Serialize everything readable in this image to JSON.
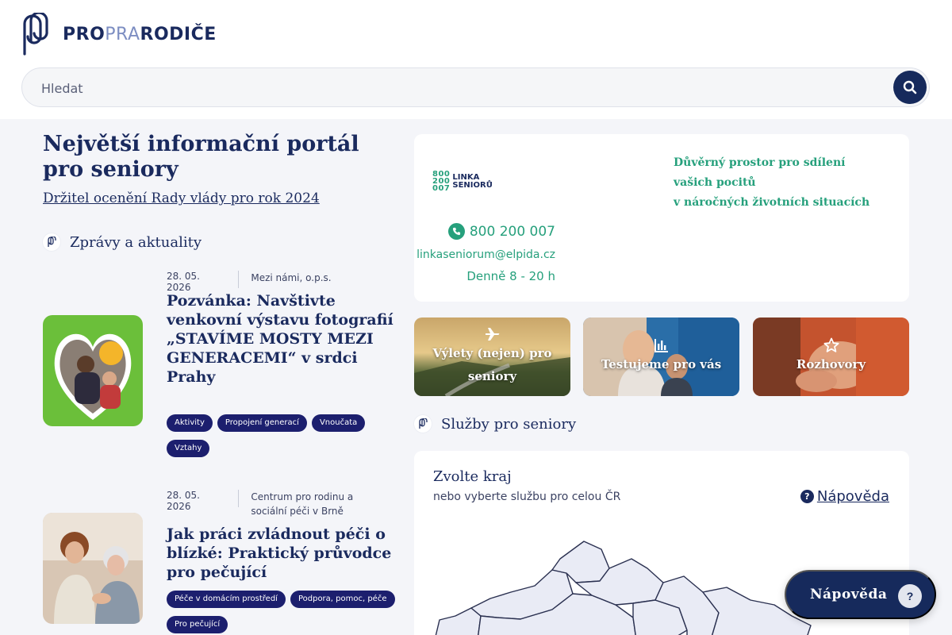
{
  "header": {
    "logo": {
      "pro1": "PRO",
      "pra": "PRA",
      "rodice": "RODIČE"
    },
    "search": {
      "placeholder": "Hledat"
    },
    "search_icon": "search-icon"
  },
  "intro": {
    "title": "Největší informační portál pro seniory",
    "award": "Držitel ocenění Rady vlády pro rok 2024"
  },
  "news": {
    "heading": "Zprávy a aktuality",
    "articles": [
      {
        "date": "28. 05. 2026",
        "org": "Mezi námi, o.p.s.",
        "title": "Pozvánka: Navštivte venkovní výstavu fotografií „STAVÍME MOSTY MEZI GENERACEMI“ v srdci Prahy",
        "tags": [
          "Aktivity",
          "Propojení generací",
          "Vnoučata",
          "Vztahy"
        ]
      },
      {
        "date": "28. 05. 2026",
        "org": "Centrum pro rodinu a sociální péči v Brně",
        "title": "Jak práci zvládnout péči o blízké: Praktický průvodce pro pečující",
        "tags": [
          "Péče v domácím prostředí",
          "Podpora, pomoc, péče",
          "Pro pečující"
        ]
      }
    ]
  },
  "linka": {
    "logo_numbers": [
      "800",
      "200",
      "007"
    ],
    "logo_word": [
      "LINKA",
      "SENIORŮ"
    ],
    "phone": "800 200 007",
    "email": "linkaseniorum@elpida.cz",
    "hours": "Denně 8 - 20 h",
    "claim_line1": "Důvěrný prostor pro sdílení vašich pocitů",
    "claim_line2": "v náročných životních situacích",
    "accent": "#26a07c"
  },
  "tiles": [
    {
      "label": "Výlety (nejen) pro seniory",
      "icon": "airplane-icon"
    },
    {
      "label": "Testujeme pro vás",
      "icon": "bar-chart-icon"
    },
    {
      "label": "Rozhovory",
      "icon": "star-icon"
    }
  ],
  "services": {
    "heading": "Služby pro seniory",
    "kraj_title": "Zvolte kraj",
    "kraj_sub": "nebo vyberte službu pro celou ČR",
    "help_link": "Nápověda"
  },
  "help_fab": {
    "label": "Nápověda",
    "q": "?"
  },
  "colors": {
    "navy": "#162a5c",
    "tag": "#1c1f6e",
    "green": "#26a07c",
    "bg": "#f4f5f9"
  }
}
